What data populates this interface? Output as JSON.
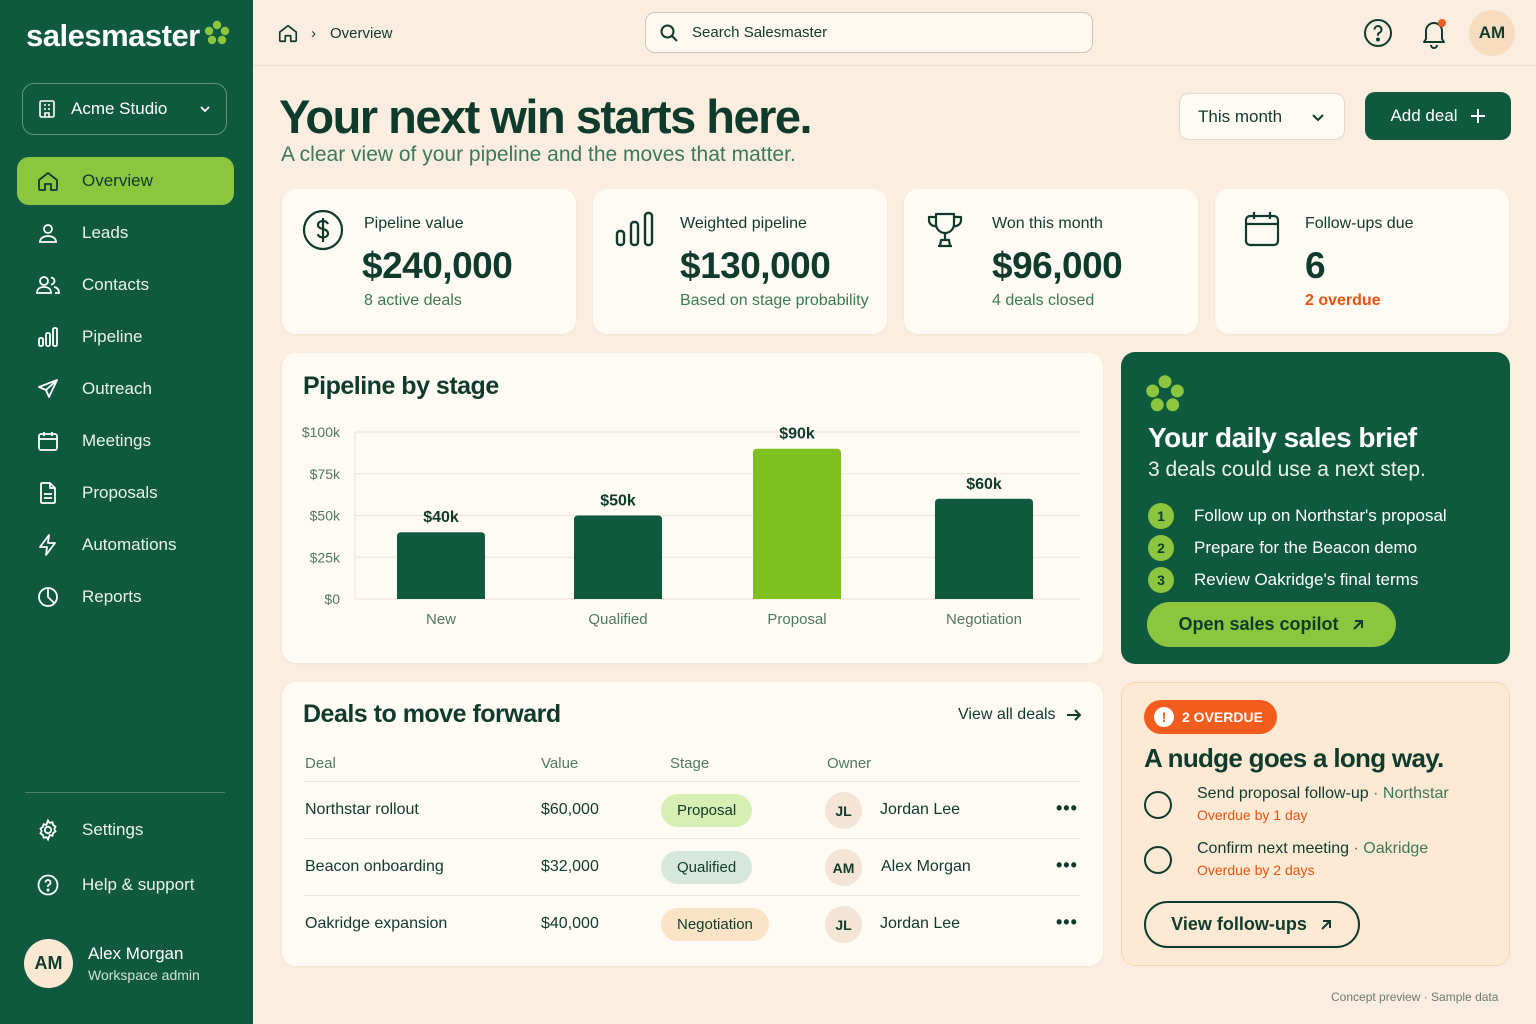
{
  "app": {
    "name": "salesmaster"
  },
  "workspace": {
    "name": "Acme Studio"
  },
  "sidebar": {
    "items": [
      {
        "label": "Overview",
        "icon": "home-icon",
        "active": true
      },
      {
        "label": "Leads",
        "icon": "user-icon"
      },
      {
        "label": "Contacts",
        "icon": "users-icon"
      },
      {
        "label": "Pipeline",
        "icon": "bar-chart-icon"
      },
      {
        "label": "Outreach",
        "icon": "send-icon"
      },
      {
        "label": "Meetings",
        "icon": "calendar-icon"
      },
      {
        "label": "Proposals",
        "icon": "document-icon"
      },
      {
        "label": "Automations",
        "icon": "lightning-icon"
      },
      {
        "label": "Reports",
        "icon": "pie-chart-icon"
      }
    ],
    "bottom": [
      {
        "label": "Settings",
        "icon": "gear-icon"
      },
      {
        "label": "Help & support",
        "icon": "help-icon"
      }
    ],
    "user": {
      "initials": "AM",
      "name": "Alex Morgan",
      "role": "Workspace admin"
    }
  },
  "topbar": {
    "breadcrumb": "Overview",
    "search_placeholder": "Search Salesmaster",
    "avatar": "AM"
  },
  "header": {
    "title": "Your next win starts here.",
    "subtitle": "A clear view of your pipeline and the moves that matter.",
    "period": "This month",
    "add_deal": "Add deal"
  },
  "stats": [
    {
      "label": "Pipeline value",
      "value": "$240,000",
      "note": "8 active deals",
      "icon": "dollar-icon"
    },
    {
      "label": "Weighted pipeline",
      "value": "$130,000",
      "note": "Based on stage probability",
      "icon": "bar-chart-icon"
    },
    {
      "label": "Won this month",
      "value": "$96,000",
      "note": "4 deals closed",
      "icon": "trophy-icon"
    },
    {
      "label": "Follow-ups due",
      "value": "6",
      "note": "2 overdue",
      "icon": "calendar-icon"
    }
  ],
  "pipeline": {
    "title": "Pipeline by stage"
  },
  "chart_data": {
    "type": "bar",
    "title": "Pipeline by stage",
    "categories": [
      "New",
      "Qualified",
      "Proposal",
      "Negotiation"
    ],
    "values": [
      40000,
      50000,
      90000,
      60000
    ],
    "data_labels": [
      "$40k",
      "$50k",
      "$90k",
      "$60k"
    ],
    "highlight_index": 2,
    "ylim": [
      0,
      100000
    ],
    "yticks": [
      0,
      25000,
      50000,
      75000,
      100000
    ],
    "ytick_labels": [
      "$0",
      "$25k",
      "$50k",
      "$75k",
      "$100k"
    ],
    "grid": true,
    "colors": {
      "bar": "#0f5a3e",
      "highlight": "#7fbf1f"
    }
  },
  "brief": {
    "title": "Your daily sales brief",
    "subtitle": "3 deals could use a next step.",
    "items": [
      {
        "num": "1",
        "text": "Follow up on Northstar's proposal"
      },
      {
        "num": "2",
        "text": "Prepare for the Beacon demo"
      },
      {
        "num": "3",
        "text": "Review Oakridge's final terms"
      }
    ],
    "cta": "Open sales copilot"
  },
  "deals": {
    "title": "Deals to move forward",
    "view_all": "View all deals",
    "columns": [
      "Deal",
      "Value",
      "Stage",
      "Owner"
    ],
    "rows": [
      {
        "deal": "Northstar rollout",
        "value": "$60,000",
        "stage": "Proposal",
        "owner_initials": "JL",
        "owner": "Jordan Lee",
        "menu": "•••"
      },
      {
        "deal": "Beacon onboarding",
        "value": "$32,000",
        "stage": "Qualified",
        "owner_initials": "AM",
        "owner": "Alex Morgan",
        "menu": "•••"
      },
      {
        "deal": "Oakridge expansion",
        "value": "$40,000",
        "stage": "Negotiation",
        "owner_initials": "JL",
        "owner": "Jordan Lee",
        "menu": "•••"
      }
    ]
  },
  "nudge": {
    "badge": "2 OVERDUE",
    "badge_icon": "!",
    "title": "A nudge goes a long way.",
    "tasks": [
      {
        "title": "Send proposal follow-up",
        "account": "· Northstar",
        "due": "Overdue by 1 day"
      },
      {
        "title": "Confirm next meeting",
        "account": "· Oakridge",
        "due": "Overdue by 2 days"
      }
    ],
    "cta": "View follow-ups"
  },
  "footer": "Concept preview · Sample data"
}
